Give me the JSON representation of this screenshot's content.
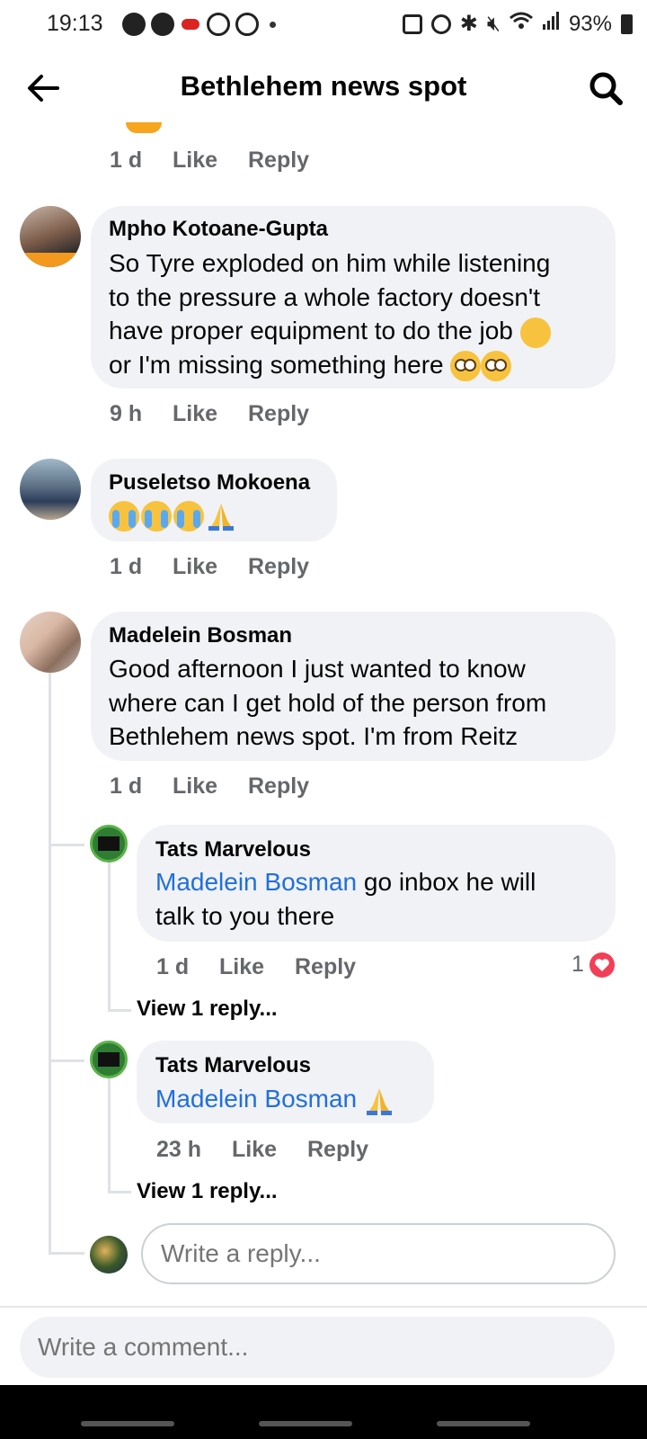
{
  "status_bar": {
    "time": "19:13",
    "battery": "93%"
  },
  "header": {
    "title": "Bethlehem news spot"
  },
  "top_meta": {
    "time": "1 d",
    "like": "Like",
    "reply": "Reply"
  },
  "comments": [
    {
      "author": "Mpho Kotoane-Gupta",
      "lines": [
        "So Tyre exploded on him while listening",
        "to the pressure a whole factory doesn't",
        "have proper equipment to do the job",
        "or I'm missing something here"
      ],
      "time": "9 h",
      "like": "Like",
      "reply": "Reply"
    },
    {
      "author": "Puseletso Mokoena",
      "time": "1 d",
      "like": "Like",
      "reply": "Reply"
    },
    {
      "author": "Madelein Bosman",
      "lines": [
        "Good afternoon I just wanted to know",
        "where can I get hold of the person from",
        "Bethlehem news spot. I'm from Reitz"
      ],
      "time": "1 d",
      "like": "Like",
      "reply": "Reply"
    }
  ],
  "replies": [
    {
      "author": "Tats Marvelous",
      "mention": "Madelein Bosman",
      "line1_rest": " go inbox he will",
      "line2": "talk to you there",
      "time": "1 d",
      "like": "Like",
      "reply": "Reply",
      "reaction_count": "1",
      "view_replies": "View 1 reply..."
    },
    {
      "author": "Tats Marvelous",
      "mention": "Madelein Bosman",
      "time": "23 h",
      "like": "Like",
      "reply": "Reply",
      "view_replies": "View 1 reply..."
    }
  ],
  "inputs": {
    "reply_placeholder": "Write a reply...",
    "comment_placeholder": "Write a comment..."
  },
  "colors": {
    "bubble": "#f0f2f5",
    "mention": "#216fdb",
    "meta_text": "#65676b",
    "reaction_heart": "#f33e58"
  }
}
